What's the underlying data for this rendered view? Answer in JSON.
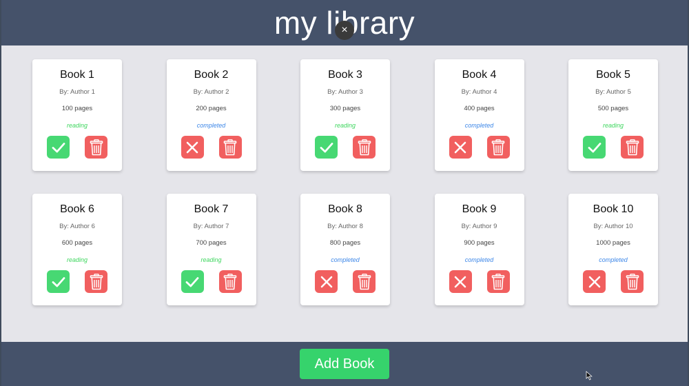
{
  "header": {
    "title": "my library",
    "close_glyph": "×"
  },
  "books": [
    {
      "title": "Book 1",
      "author": "By: Author 1",
      "pages": "100 pages",
      "status": "reading",
      "read": true
    },
    {
      "title": "Book 2",
      "author": "By: Author 2",
      "pages": "200 pages",
      "status": "completed",
      "read": false
    },
    {
      "title": "Book 3",
      "author": "By: Author 3",
      "pages": "300 pages",
      "status": "reading",
      "read": true
    },
    {
      "title": "Book 4",
      "author": "By: Author 4",
      "pages": "400 pages",
      "status": "completed",
      "read": false
    },
    {
      "title": "Book 5",
      "author": "By: Author 5",
      "pages": "500 pages",
      "status": "reading",
      "read": true
    },
    {
      "title": "Book 6",
      "author": "By: Author 6",
      "pages": "600 pages",
      "status": "reading",
      "read": true
    },
    {
      "title": "Book 7",
      "author": "By: Author 7",
      "pages": "700 pages",
      "status": "reading",
      "read": true
    },
    {
      "title": "Book 8",
      "author": "By: Author 8",
      "pages": "800 pages",
      "status": "completed",
      "read": false
    },
    {
      "title": "Book 9",
      "author": "By: Author 9",
      "pages": "900 pages",
      "status": "completed",
      "read": false
    },
    {
      "title": "Book 10",
      "author": "By: Author 10",
      "pages": "1000 pages",
      "status": "completed",
      "read": false
    }
  ],
  "footer": {
    "add_label": "Add Book"
  },
  "icons": {
    "read_toggle_true": "check-icon",
    "read_toggle_false": "x-icon",
    "delete": "trash-icon"
  },
  "colors": {
    "header_bg": "#45526a",
    "page_bg": "#e5e5ea",
    "reading": "#3ed65e",
    "completed": "#3d87e8",
    "green_button": "#47d873",
    "red_button": "#f15f5f",
    "add_button": "#36d36c"
  }
}
